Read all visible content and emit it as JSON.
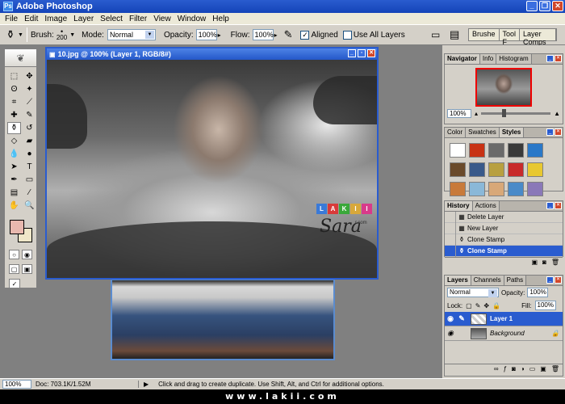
{
  "app": {
    "title": "Adobe Photoshop"
  },
  "menu": [
    "File",
    "Edit",
    "Image",
    "Layer",
    "Select",
    "Filter",
    "View",
    "Window",
    "Help"
  ],
  "options": {
    "brush_label": "Brush:",
    "brush_size": "200",
    "mode_label": "Mode:",
    "mode_value": "Normal",
    "opacity_label": "Opacity:",
    "opacity_value": "100%",
    "flow_label": "Flow:",
    "flow_value": "100%",
    "aligned_label": "Aligned",
    "use_all_layers_label": "Use All Layers",
    "well_tabs": [
      "Brushe",
      "Tool F",
      "Layer Comps"
    ]
  },
  "document": {
    "title": "10.jpg @ 100% (Layer 1, RGB/8#)"
  },
  "watermark": {
    "letters": [
      "L",
      "A",
      "K",
      "I",
      "I"
    ],
    "script": "Sara",
    "suffix": "r.com"
  },
  "navigator": {
    "tabs": [
      "Navigator",
      "Info",
      "Histogram"
    ],
    "zoom": "100%"
  },
  "styles_panel": {
    "tabs": [
      "Color",
      "Swatches",
      "Styles"
    ],
    "swatches": [
      "#ffffff",
      "#c83214",
      "#6a6a6a",
      "#3a3a3a",
      "#2a78c8",
      "#6a4a2a",
      "#3a5a8a",
      "#b8a040",
      "#c82a2a",
      "#e8c830",
      "#c87a3a",
      "#8ab8d8",
      "#d8a878",
      "#4a8ac8",
      "#8a78b8"
    ]
  },
  "history": {
    "tabs": [
      "History",
      "Actions"
    ],
    "items": [
      "Delete Layer",
      "New Layer",
      "Clone Stamp",
      "Clone Stamp"
    ]
  },
  "layers": {
    "tabs": [
      "Layers",
      "Channels",
      "Paths"
    ],
    "blend_mode": "Normal",
    "opacity_label": "Opacity:",
    "opacity_value": "100%",
    "lock_label": "Lock:",
    "fill_label": "Fill:",
    "fill_value": "100%",
    "items": [
      "Layer 1",
      "Background"
    ]
  },
  "status": {
    "zoom": "100%",
    "doc": "Doc: 703.1K/1.52M",
    "message": "Click and drag to create duplicate.  Use Shift, Alt, and Ctrl for additional options."
  },
  "footer": {
    "url": "www.lakii.com"
  }
}
